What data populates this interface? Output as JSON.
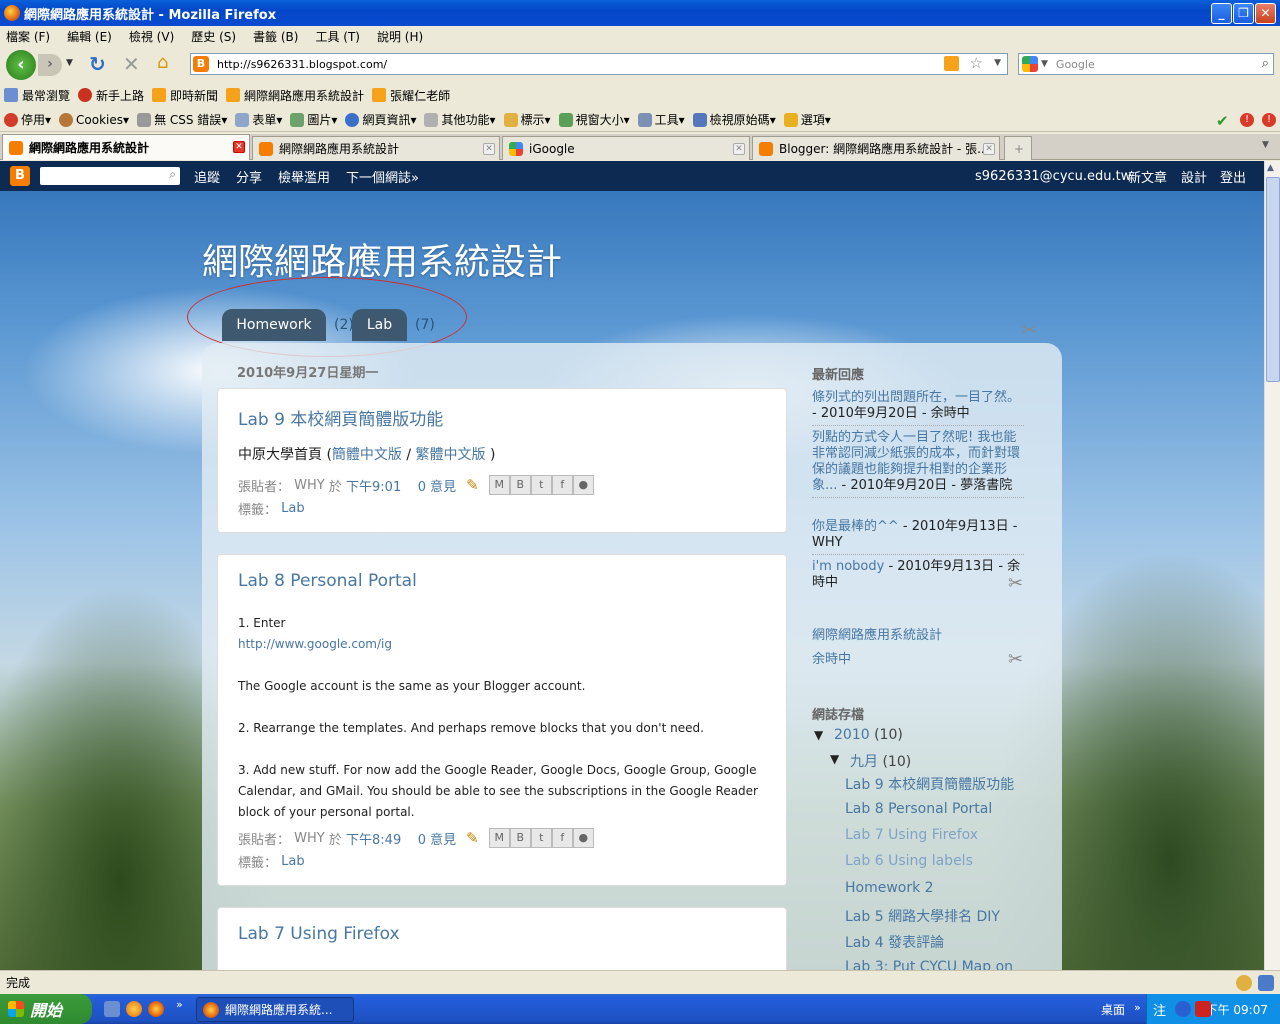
{
  "window": {
    "title": "網際網路應用系統設計 - Mozilla Firefox"
  },
  "menu": [
    "檔案 (F)",
    "編輯 (E)",
    "檢視 (V)",
    "歷史 (S)",
    "書籤 (B)",
    "工具 (T)",
    "說明 (H)"
  ],
  "nav": {
    "url": "http://s9626331.blogspot.com/",
    "search_placeholder": "Google"
  },
  "bookmarks": [
    "最常瀏覽",
    "新手上路",
    "即時新聞",
    "網際網路應用系統設計",
    "張耀仁老師"
  ],
  "devbar": [
    "停用",
    "Cookies",
    "無 CSS 錯誤",
    "表單",
    "圖片",
    "網頁資訊",
    "其他功能",
    "標示",
    "視窗大小",
    "工具",
    "檢視原始碼",
    "選項"
  ],
  "tabs": [
    {
      "label": "網際網路應用系統設計",
      "active": true
    },
    {
      "label": "網際網路應用系統設計",
      "active": false
    },
    {
      "label": "iGoogle",
      "active": false
    },
    {
      "label": "Blogger: 網際網路應用系統設計 - 張...",
      "active": false
    }
  ],
  "bloggerbar": {
    "links": [
      "追蹤",
      "分享",
      "檢舉濫用",
      "下一個網誌»"
    ],
    "email": "s9626331@cycu.edu.tw",
    "right_links": [
      "新文章",
      "設計",
      "登出"
    ]
  },
  "blog": {
    "title": "網際網路應用系統設計",
    "page_tabs": [
      {
        "label": "Homework",
        "count": "(2)"
      },
      {
        "label": "Lab",
        "count": "(7)"
      }
    ],
    "date_header": "2010年9月27日星期一"
  },
  "posts": [
    {
      "title": "Lab 9 本校網頁簡體版功能",
      "body_prefix": "中原大學首頁 (",
      "link1": "簡體中文版",
      "sep": " / ",
      "link2": "繁體中文版",
      "body_suffix": " )",
      "author_label": "張貼者：",
      "author": "WHY",
      "at": "於",
      "time": "下午9:01",
      "comments": "0 意見",
      "labels_label": "標籤：",
      "label": "Lab"
    },
    {
      "title": "Lab 8 Personal Portal",
      "lines": [
        "1. Enter",
        "http://www.google.com/ig",
        "",
        "The Google account is the same as your Blogger account.",
        "",
        "2. Rearrange the templates. And perhaps remove blocks that you don't need.",
        "",
        "3. Add new stuff. For now add the Google Reader, Google Docs, Google Group, Google",
        "Calendar, and GMail. You should be able to see the subscriptions in the Google Reader",
        "block of your personal portal."
      ],
      "author_label": "張貼者：",
      "author": "WHY",
      "at": "於",
      "time": "下午8:49",
      "comments": "0 意見",
      "labels_label": "標籤：",
      "label": "Lab"
    },
    {
      "title": "Lab 7 Using Firefox"
    }
  ],
  "sidebar": {
    "recent_comments_title": "最新回應",
    "comments": [
      {
        "text": "條列式的列出問題所在，一目了然。",
        "meta": " - 2010年9月20日 - 余時中"
      },
      {
        "text": "列點的方式令人一目了然呢! 我也能非常認同減少紙張的成本，而針對環保的議題也能夠提升相對的企業形象...",
        "meta": " - 2010年9月20日 - 夢落書院"
      },
      {
        "text": "你是最棒的^^",
        "meta": " - 2010年9月13日 - WHY"
      },
      {
        "text": "i'm nobody",
        "meta": " - 2010年9月13日 - 余時中"
      }
    ],
    "links": [
      "網際網路應用系統設計",
      "余時中"
    ],
    "archive_title": "網誌存檔",
    "archive_year": "2010",
    "archive_year_count": "(10)",
    "archive_month": "九月",
    "archive_month_count": "(10)",
    "archive_posts": [
      "Lab 9 本校網頁簡體版功能",
      "Lab 8 Personal Portal",
      "Lab 7 Using Firefox",
      "Lab 6 Using labels",
      "Homework 2",
      "Lab 5 網路大學排名 DIY",
      "Lab 4 發表評論",
      "Lab 3: Put CYCU Map on"
    ]
  },
  "status": "完成",
  "taskbar": {
    "start": "開始",
    "task": "網際網路應用系統...",
    "desktop": "桌面",
    "clock": "下午 09:07"
  }
}
